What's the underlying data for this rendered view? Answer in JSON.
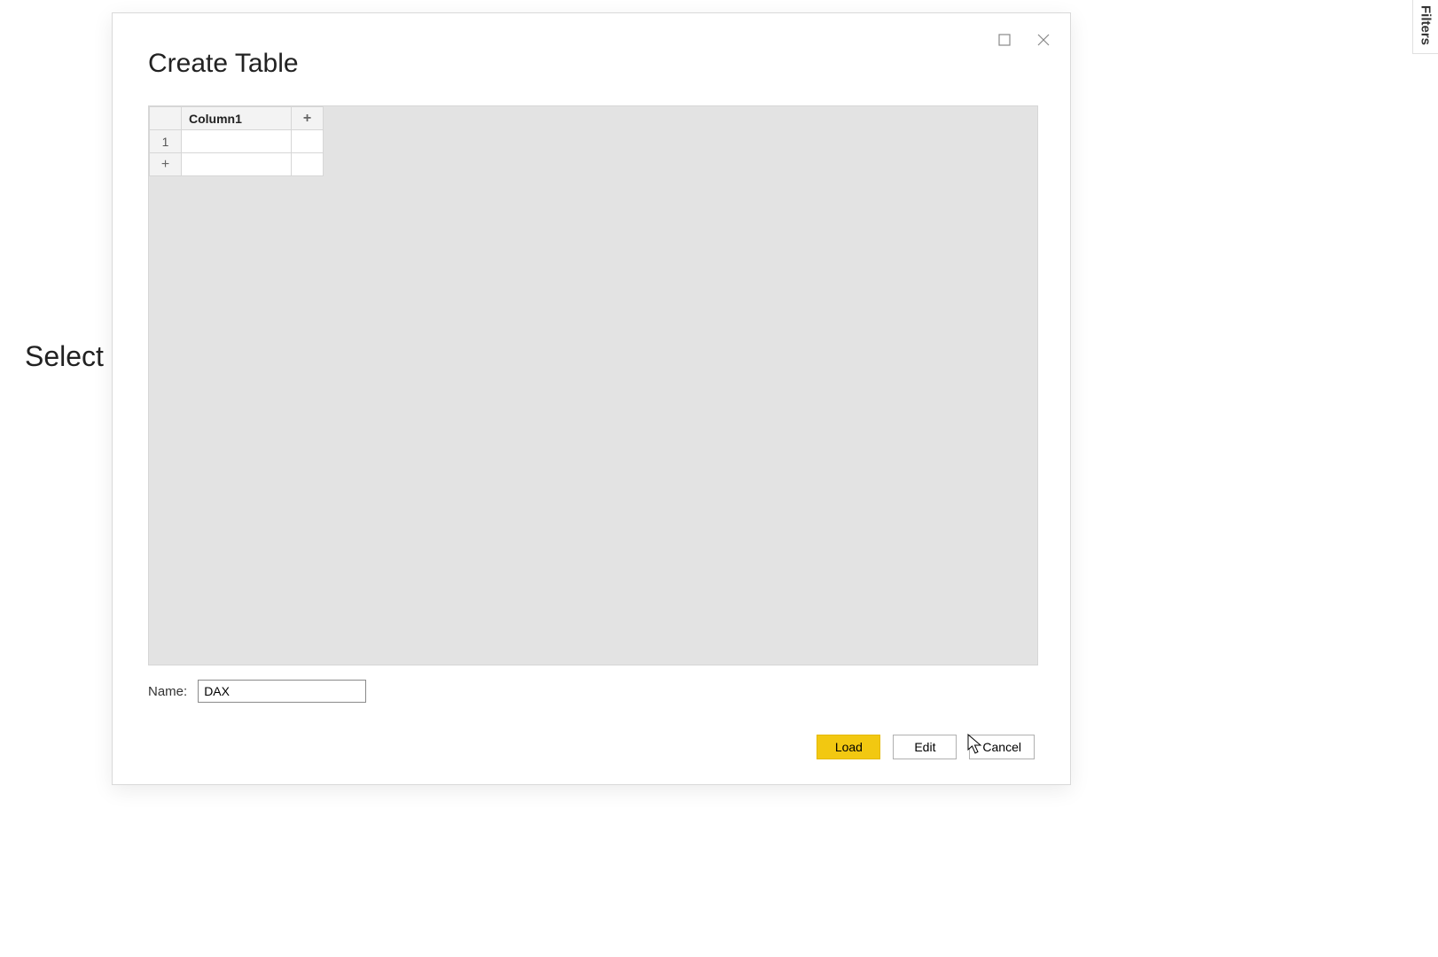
{
  "background": {
    "hint_text": "Select o"
  },
  "side_panel": {
    "filters_label": "Filters"
  },
  "dialog": {
    "title": "Create Table",
    "grid": {
      "columns": [
        "Column1"
      ],
      "add_col_glyph": "+",
      "rows": [
        "1"
      ],
      "add_row_glyph": "+",
      "cells": [
        [
          ""
        ]
      ]
    },
    "name_field": {
      "label": "Name:",
      "value": "DAX"
    },
    "buttons": {
      "load": "Load",
      "edit": "Edit",
      "cancel": "Cancel"
    }
  }
}
